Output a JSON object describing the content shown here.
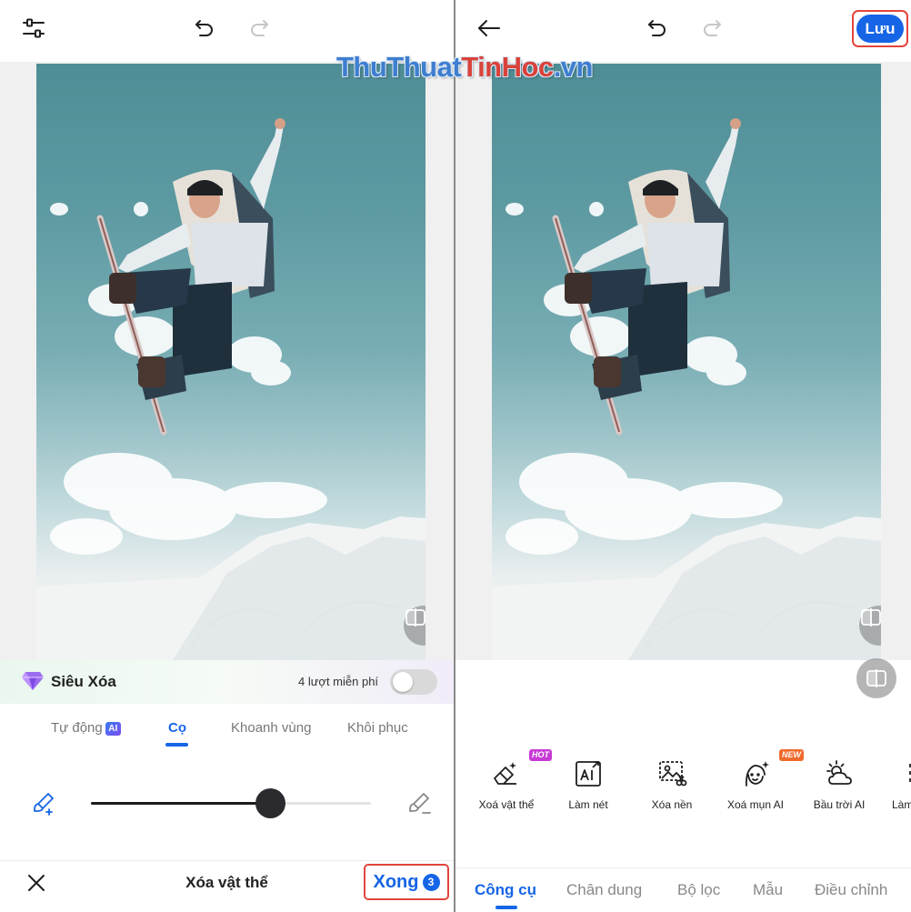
{
  "watermark": {
    "part1": "ThuThuat",
    "part2": "TinHoc",
    "part3": ".vn"
  },
  "left": {
    "sieu_xoa": {
      "title": "Siêu Xóa",
      "free_text": "4 lượt miễn phí",
      "toggle_on": false
    },
    "mode_tabs": [
      {
        "label": "Tự động",
        "badge": "AI",
        "active": false
      },
      {
        "label": "Cọ",
        "active": true
      },
      {
        "label": "Khoanh vùng",
        "active": false
      },
      {
        "label": "Khôi phục",
        "active": false
      }
    ],
    "brush_slider": {
      "value": 0.64
    },
    "bottom_bar": {
      "title": "Xóa vật thể",
      "done_label": "Xong",
      "done_count": "3"
    }
  },
  "right": {
    "save_label": "Lưu",
    "tools": [
      {
        "label": "Xoá vật thể",
        "icon": "eraser-sparkle-icon",
        "badge": "HOT"
      },
      {
        "label": "Làm nét",
        "icon": "ai-sharpen-icon"
      },
      {
        "label": "Xóa nền",
        "icon": "background-remove-icon"
      },
      {
        "label": "Xoá mụn AI",
        "icon": "face-sparkle-icon",
        "badge": "NEW"
      },
      {
        "label": "Bầu trời AI",
        "icon": "sun-cloud-icon"
      },
      {
        "label": "Làm"
      }
    ],
    "nav_tabs": [
      {
        "label": "Công cụ",
        "active": true
      },
      {
        "label": "Chân dung",
        "active": false
      },
      {
        "label": "Bộ lọc",
        "active": false
      },
      {
        "label": "Mẫu",
        "active": false
      },
      {
        "label": "Điều chỉnh",
        "active": false
      }
    ]
  },
  "colors": {
    "accent": "#1665e6",
    "highlight_border": "#e2453c",
    "hot_badge": "#c83ad6",
    "new_badge": "#ef6a2c"
  }
}
